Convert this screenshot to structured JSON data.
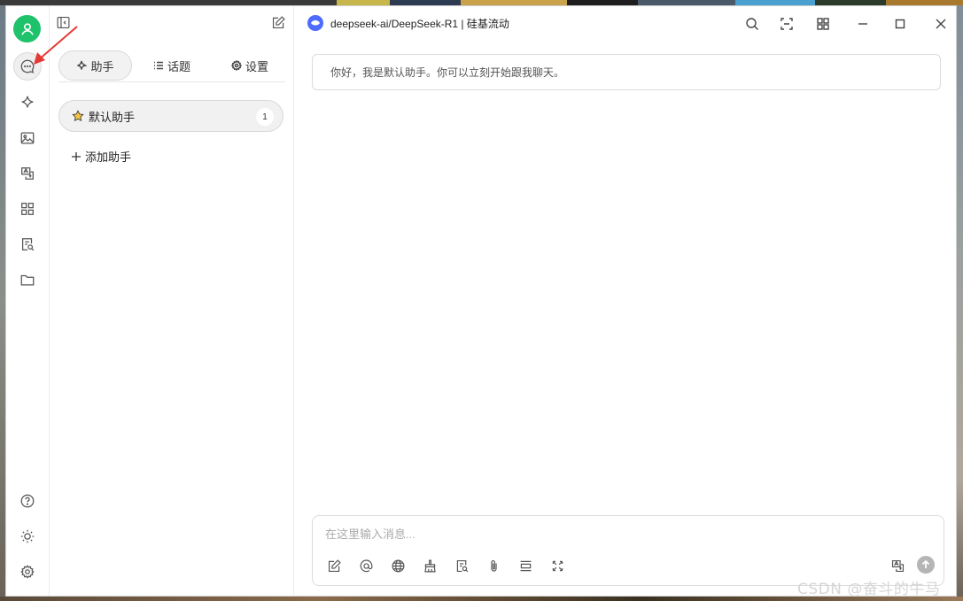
{
  "window": {
    "model_name": "deepseek-ai/DeepSeek-R1 | 硅基流动"
  },
  "sidebar": {
    "items": [
      {
        "icon": "chat-icon",
        "active": true
      },
      {
        "icon": "sparkle-icon"
      },
      {
        "icon": "image-icon"
      },
      {
        "icon": "translate-icon"
      },
      {
        "icon": "apps-icon"
      },
      {
        "icon": "knowledge-icon"
      },
      {
        "icon": "folder-icon"
      }
    ],
    "bottom": [
      "help-icon",
      "theme-icon",
      "settings-icon"
    ]
  },
  "assistant_panel": {
    "tabs": {
      "assistant": "助手",
      "topics": "话题",
      "settings": "设置"
    },
    "default_assistant": {
      "label": "默认助手",
      "count": "1"
    },
    "add_label": "添加助手"
  },
  "chat": {
    "greeting": "你好，我是默认助手。你可以立刻开始跟我聊天。",
    "input_placeholder": "在这里输入消息..."
  },
  "watermark": "CSDN @奋斗的牛马",
  "colors": {
    "accent": "#1ec26a",
    "logo": "#4d6bfe",
    "annotation": "#e53935"
  }
}
